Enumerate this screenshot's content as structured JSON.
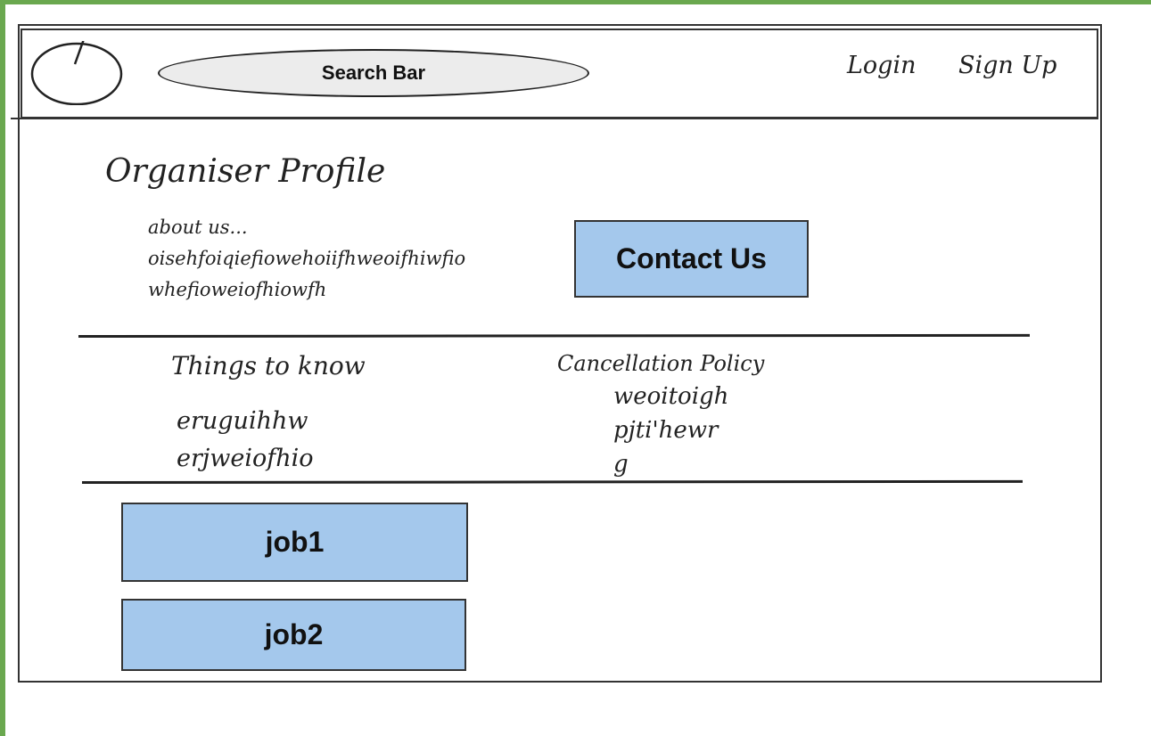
{
  "header": {
    "search_label": "Search Bar",
    "login_label": "Login",
    "signup_label": "Sign Up"
  },
  "profile": {
    "title": "Organiser Profile",
    "about_lines": [
      "about us...",
      "oisehfoiqiefiowehoiifhweoifhiwfio",
      "whefioweiofhiowfh"
    ],
    "contact_label": "Contact Us"
  },
  "things_to_know": {
    "title": "Things to know",
    "items": [
      "eruguihhw",
      "erjweiofhio"
    ]
  },
  "cancellation": {
    "title": "Cancellation Policy",
    "items": [
      "weoitoigh",
      "pjti'hewr",
      "g"
    ]
  },
  "jobs": [
    "job1",
    "job2"
  ],
  "colors": {
    "button_fill": "#a4c8ec",
    "search_fill": "#ececec",
    "border_green": "#6aa84f"
  },
  "icons": {
    "logo": "logo-circle-icon"
  }
}
